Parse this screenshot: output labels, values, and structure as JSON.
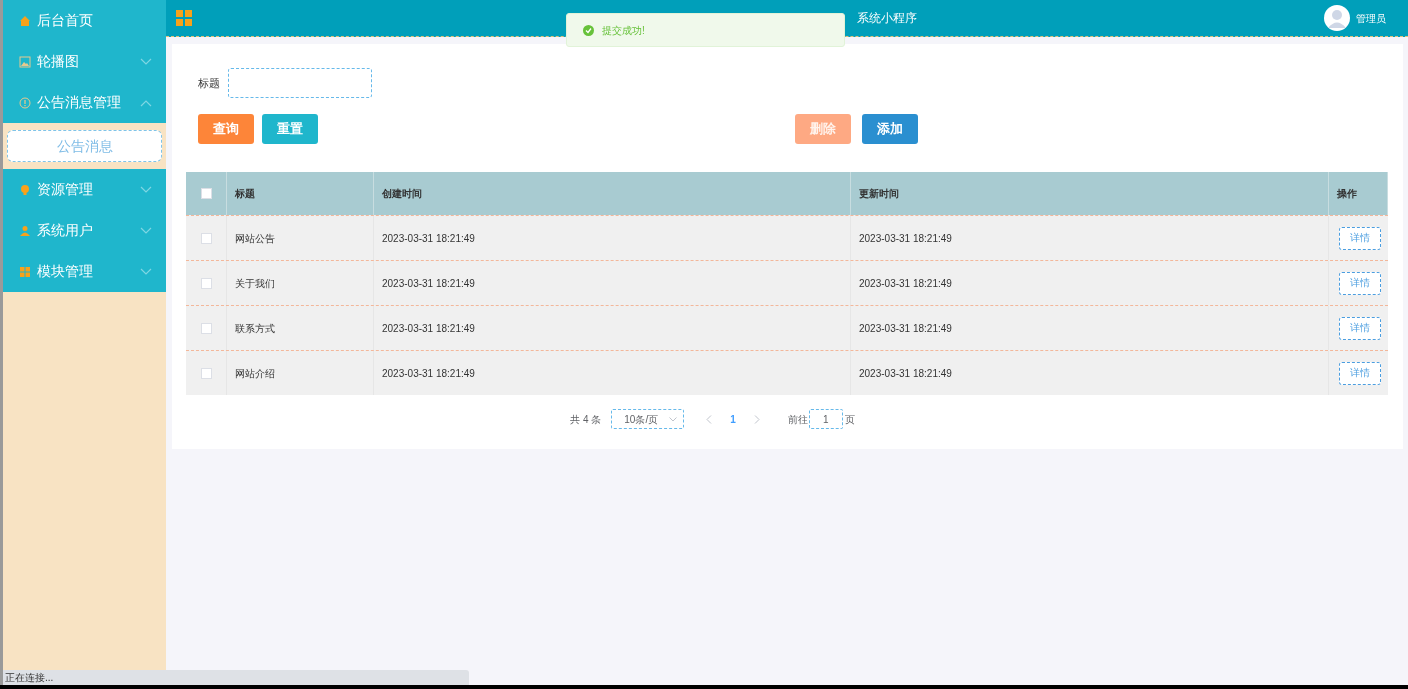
{
  "sidebar": {
    "items": [
      {
        "label": "后台首页"
      },
      {
        "label": "轮播图",
        "expanded": false
      },
      {
        "label": "公告消息管理",
        "expanded": true,
        "children": [
          {
            "label": "公告消息",
            "selected": true
          }
        ]
      },
      {
        "label": "资源管理",
        "expanded": false
      },
      {
        "label": "系统用户",
        "expanded": false
      },
      {
        "label": "模块管理",
        "expanded": false
      }
    ]
  },
  "header": {
    "title": "系统小程序",
    "user": "管理员"
  },
  "toast": {
    "message": "提交成功!"
  },
  "search": {
    "label": "标题"
  },
  "buttons": [
    {
      "label": "查询",
      "color": "#fd8539",
      "disabled": false
    },
    {
      "label": "重置",
      "color": "#1fb6cc",
      "disabled": false
    }
  ],
  "actions": [
    {
      "label": "删除",
      "color": "#fea983",
      "disabled": true
    },
    {
      "label": "添加",
      "color": "#2a8fd0",
      "disabled": false
    }
  ],
  "table": {
    "all_checked": false,
    "columns": [
      "标题",
      "创建时间",
      "更新时间",
      "操作"
    ],
    "rows": [
      {
        "checked": false,
        "cells": [
          "网站公告",
          "2023-03-31 18:21:49",
          "2023-03-31 18:21:49"
        ],
        "action": "详情"
      },
      {
        "checked": false,
        "cells": [
          "关于我们",
          "2023-03-31 18:21:49",
          "2023-03-31 18:21:49"
        ],
        "action": "详情"
      },
      {
        "checked": false,
        "cells": [
          "联系方式",
          "2023-03-31 18:21:49",
          "2023-03-31 18:21:49"
        ],
        "action": "详情"
      },
      {
        "checked": false,
        "cells": [
          "网站介绍",
          "2023-03-31 18:21:49",
          "2023-03-31 18:21:49"
        ],
        "action": "详情"
      }
    ]
  },
  "pagination": {
    "total": "共 4 条",
    "page_size": "10条/页",
    "pages": [
      {
        "label": "1",
        "selected": true
      }
    ],
    "goto_label": "前往",
    "goto_value": "1",
    "goto_suffix": "页"
  },
  "status_bar": {
    "text": "正在连接..."
  }
}
